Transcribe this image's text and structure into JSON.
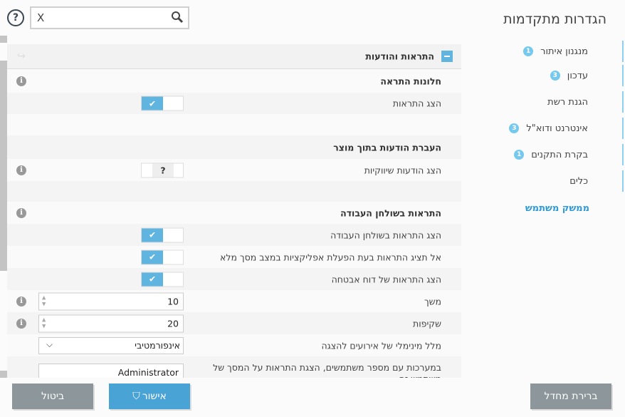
{
  "title": "הגדרות מתקדמות",
  "search": {
    "clear": "X",
    "value": ""
  },
  "sidebar": [
    {
      "label": "מנגנון איתור",
      "badge": "1"
    },
    {
      "label": "עדכון",
      "badge": "3"
    },
    {
      "label": "הגנת רשת"
    },
    {
      "label": "אינטרנט ודוא\"ל",
      "badge": "3"
    },
    {
      "label": "בקרת התקנים",
      "badge": "1"
    },
    {
      "label": "כלים"
    },
    {
      "label": "ממשק משתמש"
    }
  ],
  "section": {
    "title": "התראות והודעות"
  },
  "rows": {
    "alert_windows": "חלונות התראה",
    "show_alerts": "הצג התראות",
    "inproduct": "העברת הודעות בתוך מוצר",
    "marketing": "הצג הודעות שיווקיות",
    "marketing_state": "?",
    "desktop": "התראות בשולחן העבודה",
    "desktop_show": "הצג התראות בשולחן העבודה",
    "fullscreen": "אל תציג התראות בעת הפעלת אפליקציות במצב מסך מלא",
    "security_report": "הצג התראות של דוח אבטחה",
    "duration": "משך",
    "duration_value": "10",
    "opacity": "שקיפות",
    "opacity_value": "20",
    "verbosity": "מלל מינימלי של אירועים להצגה",
    "verbosity_value": "אינפורמטיבי",
    "multiuser": "במערכות עם מספר משתמשים, הצגת התראות על המסך של משתמש זה",
    "multiuser_value": "Administrator"
  },
  "buttons": {
    "default": "ברירת מחדל",
    "ok": "אישור",
    "cancel": "ביטול"
  }
}
